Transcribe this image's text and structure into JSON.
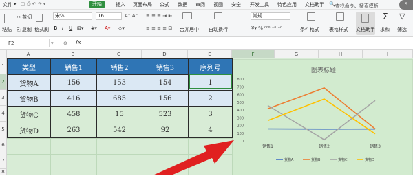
{
  "menu": {
    "file": "文件",
    "tabs": [
      "开始",
      "插入",
      "页面布局",
      "公式",
      "数据",
      "审阅",
      "视图",
      "安全",
      "开发工具",
      "特色应用",
      "文档助手"
    ],
    "search": "查找命令、搜索模板"
  },
  "ribbon": {
    "cut": "剪切",
    "paste": "粘贴",
    "copy": "复制",
    "format_painter": "格式刷",
    "font_name": "宋体",
    "font_size": "16",
    "merge_center": "合并居中",
    "wrap_text": "自动换行",
    "number_format": "常规",
    "conditional_format": "条件格式",
    "table_style": "表格样式",
    "doc_assistant": "文档助手",
    "sum": "求和",
    "filter": "筛选"
  },
  "formula_bar": {
    "name_box": "F2",
    "fx": "fx"
  },
  "columns": [
    "A",
    "B",
    "C",
    "D",
    "E",
    "F",
    "G",
    "H",
    "I"
  ],
  "rows": [
    "1",
    "2",
    "3",
    "4",
    "5",
    "6",
    "7",
    "8"
  ],
  "table": {
    "headers": [
      "类型",
      "销售1",
      "销售2",
      "销售3",
      "序列号"
    ],
    "rows": [
      [
        "货物A",
        "156",
        "153",
        "154",
        "1"
      ],
      [
        "货物B",
        "416",
        "685",
        "156",
        "2"
      ],
      [
        "货物C",
        "458",
        "15",
        "523",
        "3"
      ],
      [
        "货物D",
        "263",
        "542",
        "92",
        "4"
      ]
    ]
  },
  "chart_data": {
    "type": "line",
    "title": "图表标题",
    "categories": [
      "销售1",
      "销售2",
      "销售3"
    ],
    "series": [
      {
        "name": "货物A",
        "values": [
          156,
          153,
          154
        ],
        "color": "#4472c4"
      },
      {
        "name": "货物B",
        "values": [
          416,
          685,
          156
        ],
        "color": "#ed7d31"
      },
      {
        "name": "货物C",
        "values": [
          458,
          15,
          523
        ],
        "color": "#a5a5a5"
      },
      {
        "name": "货物D",
        "values": [
          263,
          542,
          92
        ],
        "color": "#ffc000"
      }
    ],
    "ylim": [
      0,
      800
    ],
    "yticks": [
      "0",
      "100",
      "200",
      "300",
      "400",
      "500",
      "600",
      "700",
      "800"
    ],
    "legend": "bottom"
  },
  "colors": {
    "header_blue": "#2f75b5",
    "row_blue": "#dbe8f4",
    "row_green": "#d8ecd6",
    "accent_green": "#2f8f3f",
    "arrow_red": "#e02020"
  }
}
